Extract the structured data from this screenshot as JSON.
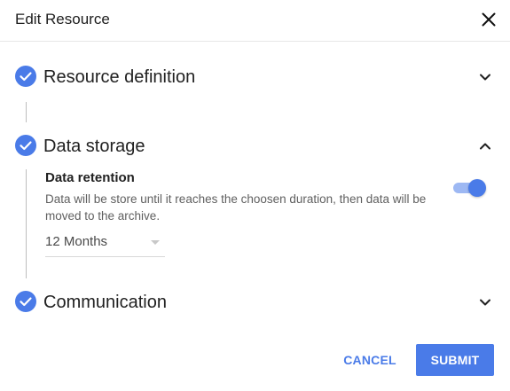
{
  "dialog": {
    "title": "Edit Resource",
    "close_icon": "close-icon"
  },
  "steps": [
    {
      "title": "Resource definition",
      "status": "completed",
      "expanded": false
    },
    {
      "title": "Data storage",
      "status": "completed",
      "expanded": true
    },
    {
      "title": "Communication",
      "status": "completed",
      "expanded": false
    }
  ],
  "data_storage": {
    "retention_title": "Data retention",
    "retention_description": "Data will be store until it reaches the choosen duration, then data will be moved to the archive.",
    "retention_enabled": true,
    "duration_selected": "12 Months"
  },
  "actions": {
    "cancel_label": "CANCEL",
    "submit_label": "SUBMIT"
  },
  "colors": {
    "accent": "#4a7be8",
    "toggle_track": "#9db8f3",
    "connector": "#bdbdbd"
  }
}
